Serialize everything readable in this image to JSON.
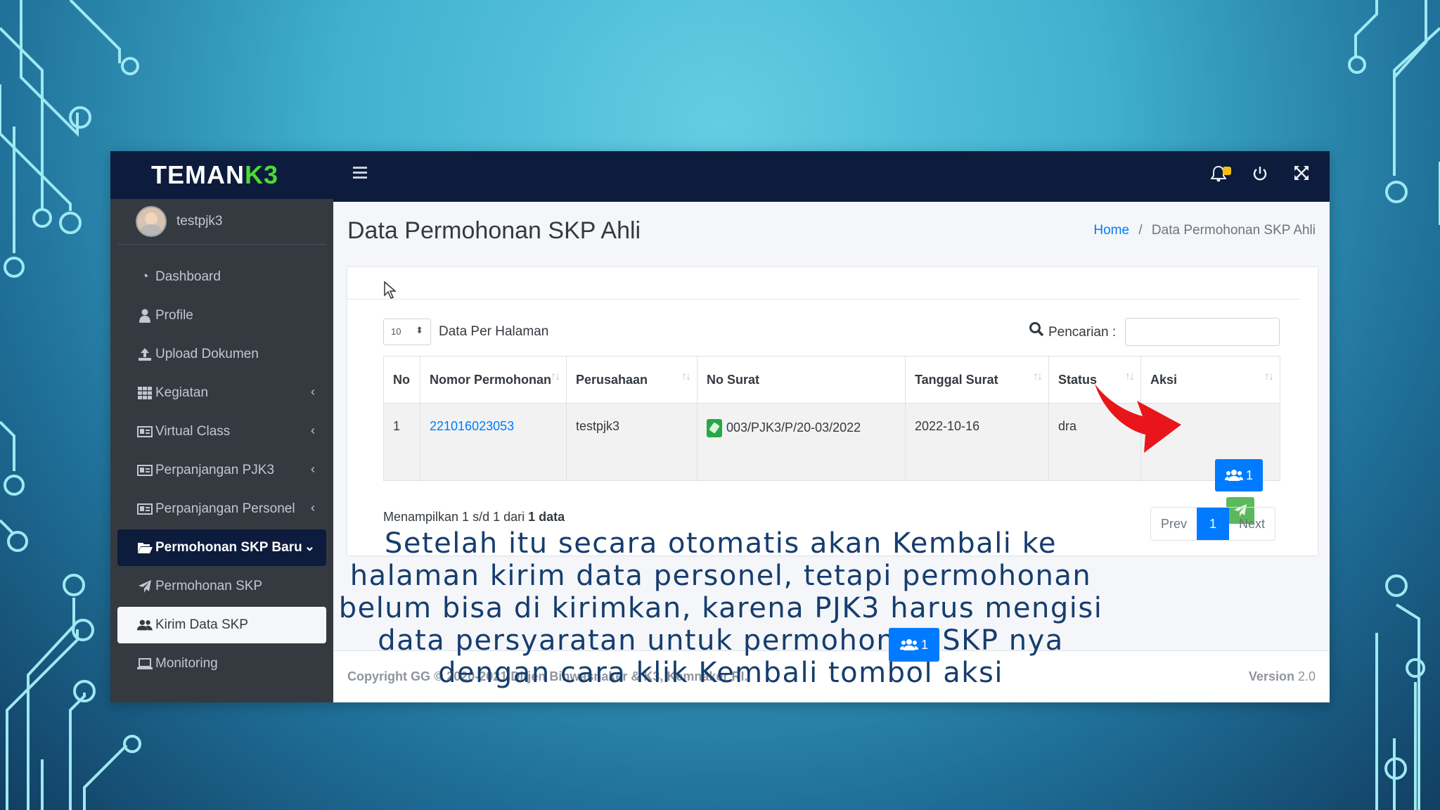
{
  "brand": {
    "part1": "TEMAN",
    "part2": "K3"
  },
  "user": {
    "name": "testpjk3"
  },
  "sidebar": {
    "items": [
      {
        "label": "Dashboard",
        "icon": "dashboard-icon"
      },
      {
        "label": "Profile",
        "icon": "user-icon"
      },
      {
        "label": "Upload Dokumen",
        "icon": "upload-icon"
      },
      {
        "label": "Kegiatan",
        "icon": "grid-icon"
      },
      {
        "label": "Virtual Class",
        "icon": "id-card-icon"
      },
      {
        "label": "Perpanjangan PJK3",
        "icon": "id-card-icon"
      },
      {
        "label": "Perpanjangan Personel",
        "icon": "id-card-icon"
      },
      {
        "label": "Permohonan SKP Baru",
        "icon": "folder-open-icon"
      },
      {
        "label": "Permohonan SKP",
        "icon": "paper-plane-icon"
      },
      {
        "label": "Kirim Data SKP",
        "icon": "users-icon"
      },
      {
        "label": "Monitoring",
        "icon": "laptop-icon"
      }
    ]
  },
  "page": {
    "title": "Data Permohonan SKP Ahli"
  },
  "breadcrumb": {
    "home": "Home",
    "separator": "/",
    "current": "Data Permohonan SKP Ahli"
  },
  "controls": {
    "page_length": "10",
    "page_length_label": "Data Per Halaman",
    "search_label": "Pencarian :",
    "search_value": ""
  },
  "table": {
    "headers": [
      "No",
      "Nomor Permohonan",
      "Perusahaan",
      "No Surat",
      "Tanggal Surat",
      "Status",
      "Aksi"
    ],
    "rows": [
      {
        "no": "1",
        "nomor": "221016023053",
        "perusahaan": "testpjk3",
        "no_surat": "003/PJK3/P/20-03/2022",
        "tanggal": "2022-10-16",
        "status": "dra",
        "member_count": "1"
      }
    ]
  },
  "info": {
    "prefix": "Menampilkan 1 s/d 1 dari ",
    "bold": "1 data"
  },
  "pagination": {
    "prev": "Prev",
    "current": "1",
    "next": "Next"
  },
  "footer": {
    "copyright": "Copyright GG © 2020-2021 Ditjen Binwasnaker & K3, Kemnaker RI.",
    "version_label": "Version",
    "version": "2.0"
  },
  "caption": {
    "text": "Setelah itu secara otomatis akan Kembali ke halaman kirim data personel, tetapi permohonan belum bisa di kirimkan, karena PJK3 harus mengisi data persyaratan untuk permohonan SKP nya dengan cara klik Kembali tombol aksi",
    "button_count": "1"
  },
  "colors": {
    "accent": "#007bff",
    "brand_green": "#4cd937",
    "topbar": "#0d1c3c",
    "sidebar": "#343a40",
    "arrow": "#e8161b"
  }
}
